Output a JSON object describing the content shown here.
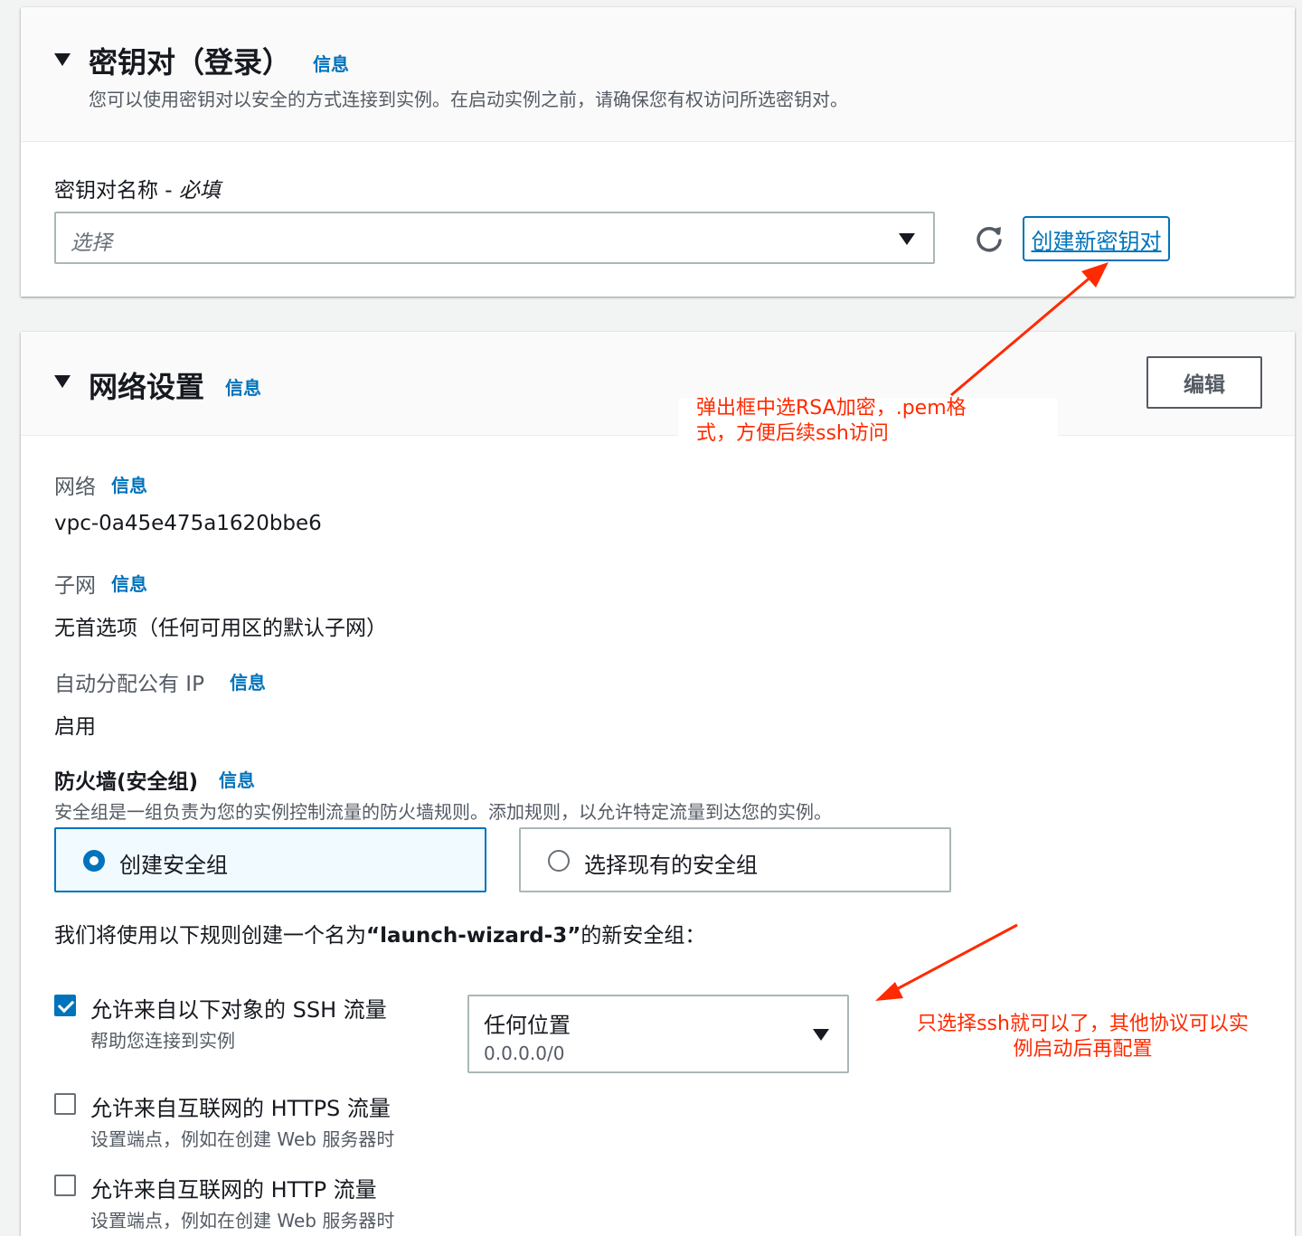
{
  "key_pair": {
    "title": "密钥对（登录）",
    "info": "信息",
    "description": "您可以使用密钥对以安全的方式连接到实例。在启动实例之前，请确保您有权访问所选密钥对。",
    "name_label": "密钥对名称 - ",
    "name_required": "必填",
    "select_placeholder": "选择",
    "create_link": "创建新密钥对"
  },
  "network": {
    "title": "网络设置",
    "info": "信息",
    "edit_button": "编辑",
    "network_label": "网络",
    "network_value": "vpc-0a45e475a1620bbe6",
    "subnet_label": "子网",
    "subnet_value": "无首选项（任何可用区的默认子网）",
    "public_ip_label": "自动分配公有 IP",
    "public_ip_value": "启用",
    "firewall_label": "防火墙(安全组)",
    "firewall_desc": "安全组是一组负责为您的实例控制流量的防火墙规则。添加规则，以允许特定流量到达您的实例。",
    "sg_create": "创建安全组",
    "sg_existing": "选择现有的安全组",
    "sg_note_prefix": "我们将使用以下规则创建一个名为",
    "sg_note_name": "“launch-wizard-3”",
    "sg_note_suffix": "的新安全组：",
    "rules": [
      {
        "label": "允许来自以下对象的 SSH 流量",
        "sub": "帮助您连接到实例",
        "checked": true
      },
      {
        "label": "允许来自互联网的 HTTPS 流量",
        "sub": "设置端点，例如在创建 Web 服务器时",
        "checked": false
      },
      {
        "label": "允许来自互联网的 HTTP 流量",
        "sub": "设置端点，例如在创建 Web 服务器时",
        "checked": false
      }
    ],
    "ssh_source": {
      "title": "任何位置",
      "cidr": "0.0.0.0/0"
    }
  },
  "annotations": {
    "note1_line1": "弹出框中选RSA加密，.pem格",
    "note1_line2": "式，方便后续ssh访问",
    "note2_line1": "只选择ssh就可以了，其他协议可以实",
    "note2_line2": "例启动后再配置",
    "color": "#ff2a00"
  }
}
